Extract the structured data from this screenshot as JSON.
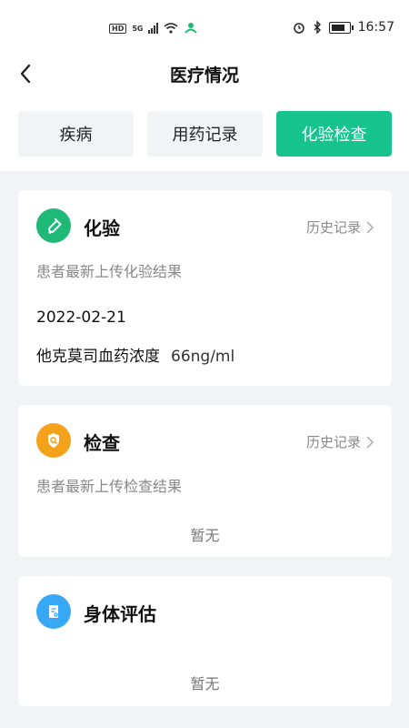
{
  "status_bar": {
    "hd": "HD",
    "network": "5G",
    "time": "16:57"
  },
  "header": {
    "title": "医疗情况"
  },
  "tabs": [
    {
      "label": "疾病",
      "active": false
    },
    {
      "label": "用药记录",
      "active": false
    },
    {
      "label": "化验检查",
      "active": true
    }
  ],
  "lab": {
    "title": "化验",
    "history_label": "历史记录",
    "description": "患者最新上传化验结果",
    "date": "2022-02-21",
    "item_name": "他克莫司血药浓度",
    "item_value": "66ng/ml"
  },
  "exam": {
    "title": "检查",
    "history_label": "历史记录",
    "description": "患者最新上传检查结果",
    "empty_text": "暂无"
  },
  "assessment": {
    "title": "身体评估",
    "empty_text": "暂无"
  },
  "colors": {
    "accent": "#17c38d",
    "lab_icon": "#1fb977",
    "exam_icon": "#f5a21b",
    "assessment_icon": "#36a8f5"
  }
}
